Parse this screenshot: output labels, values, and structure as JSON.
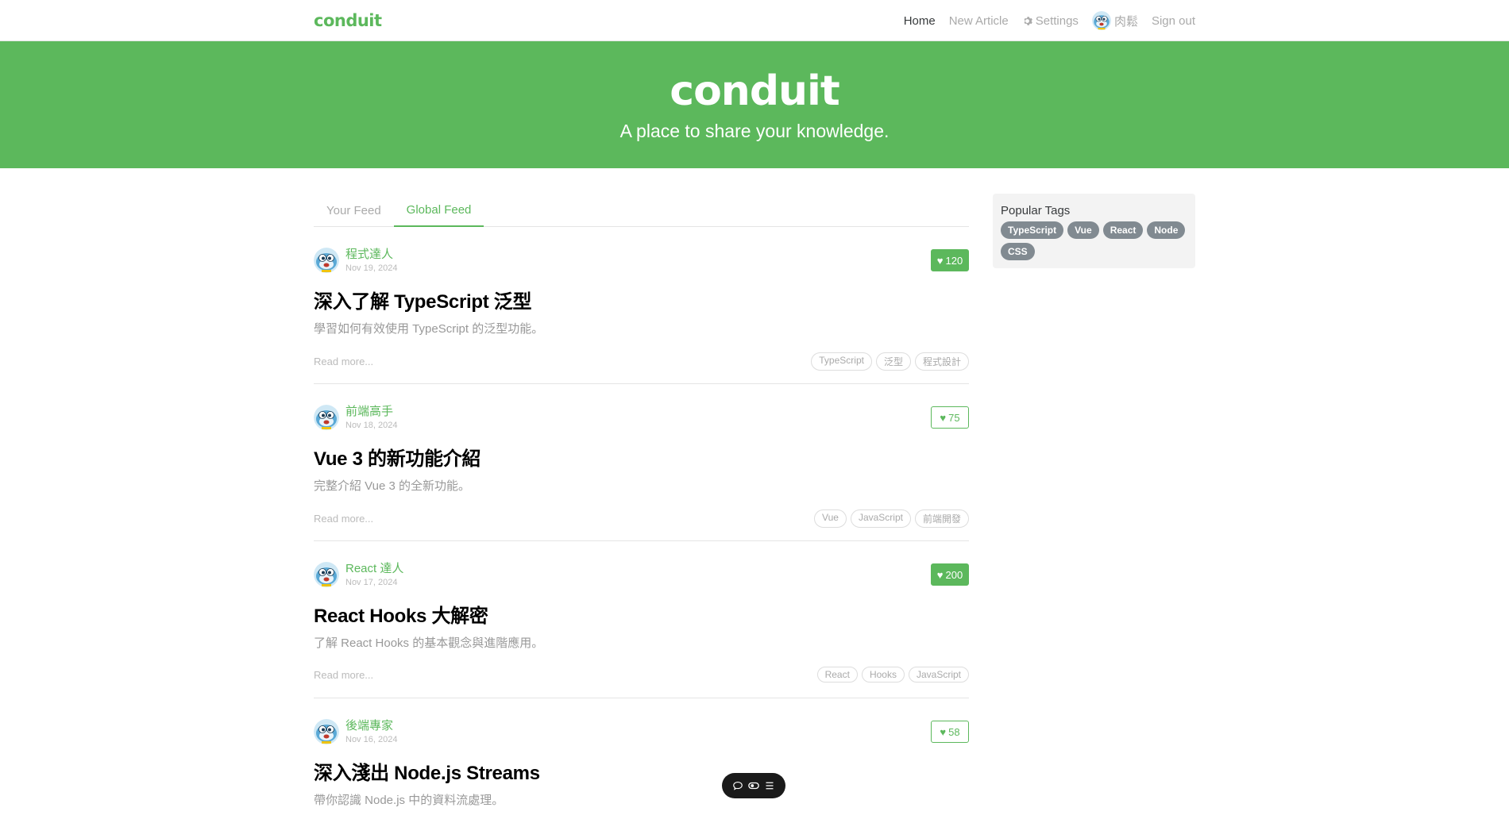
{
  "nav": {
    "brand": "conduit",
    "links": [
      {
        "label": "Home",
        "active": true
      },
      {
        "label": "New Article",
        "active": false
      },
      {
        "label": "Settings",
        "icon": "gear-icon",
        "active": false
      },
      {
        "label": "肉鬆",
        "icon": "avatar",
        "active": false
      },
      {
        "label": "Sign out",
        "active": false
      }
    ]
  },
  "banner": {
    "title": "conduit",
    "subtitle": "A place to share your knowledge."
  },
  "tabs": [
    {
      "label": "Your Feed",
      "active": false
    },
    {
      "label": "Global Feed",
      "active": true
    }
  ],
  "articles": [
    {
      "author": "程式達人",
      "date": "Nov 19, 2024",
      "likes": "120",
      "liked": true,
      "title": "深入了解 TypeScript 泛型",
      "description": "學習如何有效使用 TypeScript 的泛型功能。",
      "read_more": "Read more...",
      "tags": [
        "TypeScript",
        "泛型",
        "程式設計"
      ]
    },
    {
      "author": "前端高手",
      "date": "Nov 18, 2024",
      "likes": "75",
      "liked": false,
      "title": "Vue 3 的新功能介紹",
      "description": "完整介紹 Vue 3 的全新功能。",
      "read_more": "Read more...",
      "tags": [
        "Vue",
        "JavaScript",
        "前端開發"
      ]
    },
    {
      "author": "React 達人",
      "date": "Nov 17, 2024",
      "likes": "200",
      "liked": true,
      "title": "React Hooks 大解密",
      "description": "了解 React Hooks 的基本觀念與進階應用。",
      "read_more": "Read more...",
      "tags": [
        "React",
        "Hooks",
        "JavaScript"
      ]
    },
    {
      "author": "後端專家",
      "date": "Nov 16, 2024",
      "likes": "58",
      "liked": false,
      "title": "深入淺出 Node.js Streams",
      "description": "帶你認識 Node.js 中的資料流處理。",
      "read_more": "Read more...",
      "tags": []
    }
  ],
  "sidebar": {
    "title": "Popular Tags",
    "tags": [
      "TypeScript",
      "Vue",
      "React",
      "Node",
      "CSS"
    ]
  },
  "float_bar": {
    "icons": [
      "comment-icon",
      "toggle-icon",
      "menu-icon"
    ]
  },
  "colors": {
    "brand": "#5cb85c",
    "tag_bg": "#818a91",
    "sidebar_bg": "#f3f3f3"
  }
}
